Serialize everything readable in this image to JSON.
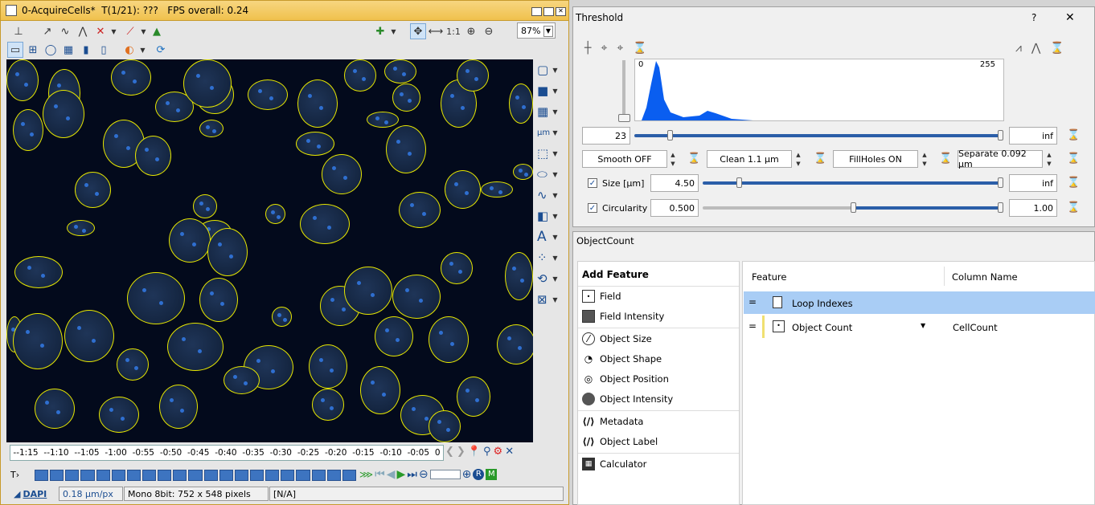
{
  "acquisition": {
    "title": "0-AcquireCells*  T(1/21): ???   FPS overall: 0.24",
    "zoom": "87%",
    "one_to_one": "1:1",
    "timeline_ticks": [
      "--1:15",
      "--1:10",
      "--1:05",
      "-1:00",
      "-0:55",
      "-0:50",
      "-0:45",
      "-0:40",
      "-0:35",
      "-0:30",
      "-0:25",
      "-0:20",
      "-0:15",
      "-0:10",
      "-0:05",
      "0"
    ],
    "t_label": "T›",
    "channel_tab": "DAPI",
    "pixel_size": "0.18 µm/px",
    "image_info": "Mono 8bit: 752 x 548 pixels",
    "status": "[N/A]"
  },
  "threshold": {
    "title": "Threshold",
    "help": "?",
    "close": "✕",
    "hist_min": "0",
    "hist_max": "255",
    "low_value": "23",
    "high_value": "inf",
    "smooth": "Smooth OFF",
    "clean": "Clean 1.1 µm",
    "fillholes": "FillHoles ON",
    "separate": "Separate 0.092 µm",
    "size_label": "Size [µm]",
    "size_min": "4.50",
    "size_max": "inf",
    "circ_label": "Circularity",
    "circ_min": "0.500",
    "circ_max": "1.00",
    "size_checked": true,
    "circ_checked": true
  },
  "objectcount": {
    "title": "ObjectCount",
    "add_feature_header": "Add Feature",
    "features": [
      "Field",
      "Field Intensity",
      "Object Size",
      "Object Shape",
      "Object Position",
      "Object Intensity",
      "Metadata",
      "Object Label",
      "Calculator"
    ],
    "col_feature": "Feature",
    "col_column_name": "Column Name",
    "rows": [
      {
        "feature": "Loop Indexes",
        "column": ""
      },
      {
        "feature": "Object Count",
        "column": "CellCount"
      }
    ],
    "handle": "="
  }
}
